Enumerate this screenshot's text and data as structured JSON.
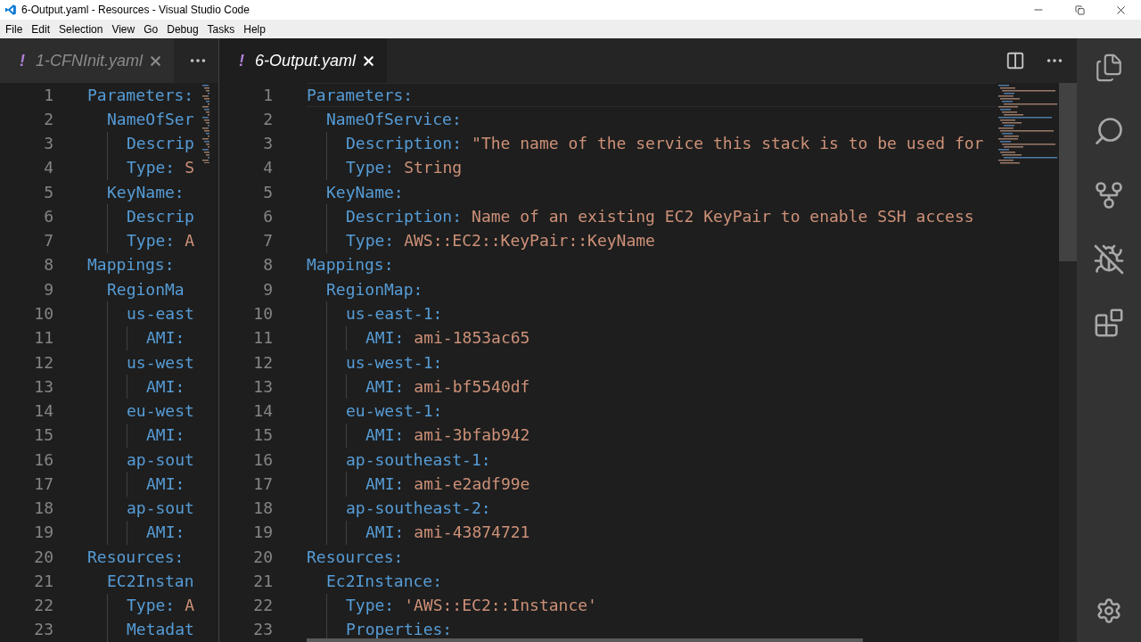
{
  "window": {
    "title": "6-Output.yaml - Resources - Visual Studio Code"
  },
  "menu": [
    "File",
    "Edit",
    "Selection",
    "View",
    "Go",
    "Debug",
    "Tasks",
    "Help"
  ],
  "editor_groups": [
    {
      "focused": false,
      "tab": {
        "badge": "!",
        "label": "1-CFNInit.yaml"
      },
      "lines": [
        {
          "number": "1",
          "key": "Parameters:",
          "children": [
            {
              "number": "2",
              "key": "NameOfSer",
              "children": [
                {
                  "number": "3",
                  "key": "Descrip"
                },
                {
                  "number": "4",
                  "key": "Type:",
                  "value": "S"
                }
              ]
            },
            {
              "number": "5",
              "key": "KeyName:",
              "children": [
                {
                  "number": "6",
                  "key": "Descrip"
                },
                {
                  "number": "7",
                  "key": "Type:",
                  "value": "A"
                }
              ]
            }
          ]
        },
        {
          "number": "8",
          "key": "Mappings:",
          "children": [
            {
              "number": "9",
              "key": "RegionMa",
              "children": [
                {
                  "number": "10",
                  "key": "us-east",
                  "children": [
                    {
                      "number": "11",
                      "key": "AMI:"
                    }
                  ]
                },
                {
                  "number": "12",
                  "key": "us-west",
                  "children": [
                    {
                      "number": "13",
                      "key": "AMI:"
                    }
                  ]
                },
                {
                  "number": "14",
                  "key": "eu-west",
                  "children": [
                    {
                      "number": "15",
                      "key": "AMI:"
                    }
                  ]
                },
                {
                  "number": "16",
                  "key": "ap-sout",
                  "children": [
                    {
                      "number": "17",
                      "key": "AMI:"
                    }
                  ]
                },
                {
                  "number": "18",
                  "key": "ap-sout",
                  "children": [
                    {
                      "number": "19",
                      "key": "AMI:"
                    }
                  ]
                }
              ]
            }
          ]
        },
        {
          "number": "20",
          "key": "Resources:",
          "children": [
            {
              "number": "21",
              "key": "EC2Instan",
              "children": [
                {
                  "number": "22",
                  "key": "Type:",
                  "value": "A"
                },
                {
                  "number": "23",
                  "key": "Metadat"
                }
              ]
            }
          ]
        }
      ]
    },
    {
      "focused": true,
      "tab": {
        "badge": "!",
        "label": "6-Output.yaml"
      },
      "lines": [
        {
          "number": "1",
          "key": "Parameters:",
          "children": [
            {
              "number": "2",
              "key": "NameOfService:",
              "children": [
                {
                  "number": "3",
                  "key": "Description:",
                  "value": "\"The name of the service this stack is to be used for"
                },
                {
                  "number": "4",
                  "key": "Type:",
                  "value": "String"
                }
              ]
            },
            {
              "number": "5",
              "key": "KeyName:",
              "children": [
                {
                  "number": "6",
                  "key": "Description:",
                  "value": "Name of an existing EC2 KeyPair to enable SSH access"
                },
                {
                  "number": "7",
                  "key": "Type:",
                  "value": "AWS::EC2::KeyPair::KeyName"
                }
              ]
            }
          ]
        },
        {
          "number": "8",
          "key": "Mappings:",
          "children": [
            {
              "number": "9",
              "key": "RegionMap:",
              "children": [
                {
                  "number": "10",
                  "key": "us-east-1:",
                  "children": [
                    {
                      "number": "11",
                      "key": "AMI:",
                      "value": "ami-1853ac65"
                    }
                  ]
                },
                {
                  "number": "12",
                  "key": "us-west-1:",
                  "children": [
                    {
                      "number": "13",
                      "key": "AMI:",
                      "value": "ami-bf5540df"
                    }
                  ]
                },
                {
                  "number": "14",
                  "key": "eu-west-1:",
                  "children": [
                    {
                      "number": "15",
                      "key": "AMI:",
                      "value": "ami-3bfab942"
                    }
                  ]
                },
                {
                  "number": "16",
                  "key": "ap-southeast-1:",
                  "children": [
                    {
                      "number": "17",
                      "key": "AMI:",
                      "value": "ami-e2adf99e"
                    }
                  ]
                },
                {
                  "number": "18",
                  "key": "ap-southeast-2:",
                  "children": [
                    {
                      "number": "19",
                      "key": "AMI:",
                      "value": "ami-43874721"
                    }
                  ]
                }
              ]
            }
          ]
        },
        {
          "number": "20",
          "key": "Resources:",
          "children": [
            {
              "number": "21",
              "key": "Ec2Instance:",
              "children": [
                {
                  "number": "22",
                  "key": "Type:",
                  "value": "'AWS::EC2::Instance'"
                },
                {
                  "number": "23",
                  "key": "Properties:"
                }
              ]
            }
          ]
        }
      ]
    }
  ]
}
